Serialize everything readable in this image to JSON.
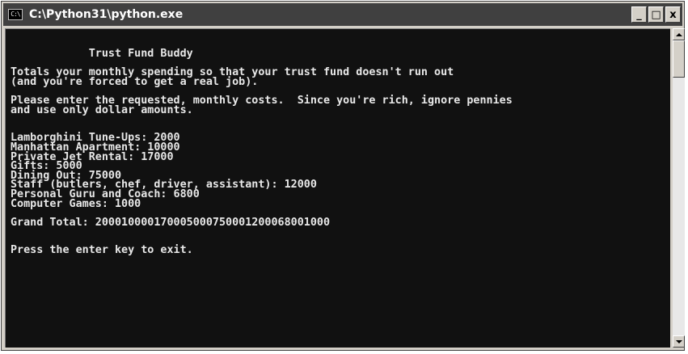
{
  "window": {
    "title": "C:\\Python31\\python.exe",
    "icon_text": "C:\\",
    "buttons": {
      "minimize": "_",
      "maximize": "□",
      "close": "x"
    }
  },
  "console": {
    "lines": [
      "            Trust Fund Buddy",
      "",
      "Totals your monthly spending so that your trust fund doesn't run out",
      "(and you're forced to get a real job).",
      "",
      "Please enter the requested, monthly costs.  Since you're rich, ignore pennies",
      "and use only dollar amounts.",
      "",
      "",
      "Lamborghini Tune-Ups: 2000",
      "Manhattan Apartment: 10000",
      "Private Jet Rental: 17000",
      "Gifts: 5000",
      "Dining Out: 75000",
      "Staff (butlers, chef, driver, assistant): 12000",
      "Personal Guru and Coach: 6800",
      "Computer Games: 1000",
      "",
      "Grand Total: 20001000017000500075000120006800 1000",
      "",
      "",
      "Press the enter key to exit."
    ]
  },
  "colors": {
    "titlebar": "#404040",
    "console_bg": "#111111",
    "console_text": "#e8e8e8"
  }
}
